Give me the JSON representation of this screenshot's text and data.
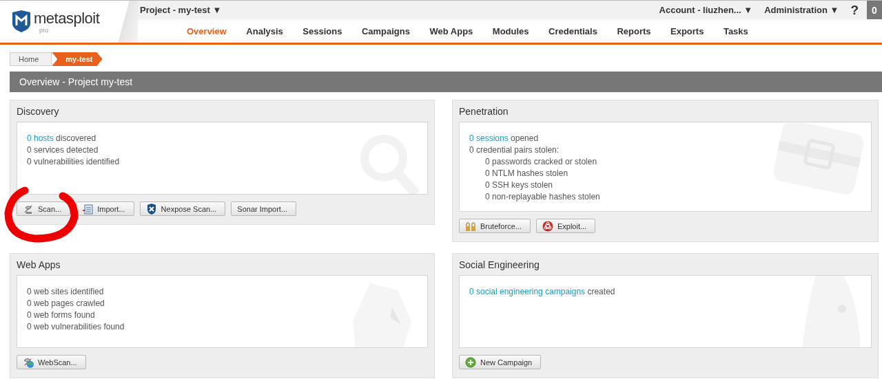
{
  "header": {
    "logo": {
      "name": "metasploit",
      "edition": "pro"
    },
    "project_menu": "Project - my-test ▼",
    "account_menu": "Account - liuzhen... ▼",
    "admin_menu": "Administration ▼",
    "help": "?",
    "notification_count": "0"
  },
  "nav": [
    {
      "label": "Overview",
      "selected": true
    },
    {
      "label": "Analysis",
      "selected": false
    },
    {
      "label": "Sessions",
      "selected": false
    },
    {
      "label": "Campaigns",
      "selected": false
    },
    {
      "label": "Web Apps",
      "selected": false
    },
    {
      "label": "Modules",
      "selected": false
    },
    {
      "label": "Credentials",
      "selected": false
    },
    {
      "label": "Reports",
      "selected": false
    },
    {
      "label": "Exports",
      "selected": false
    },
    {
      "label": "Tasks",
      "selected": false
    }
  ],
  "breadcrumb": [
    {
      "label": "Home",
      "selected": false
    },
    {
      "label": "my-test",
      "selected": true
    }
  ],
  "page_title": "Overview - Project my-test",
  "panels": [
    {
      "kind": "discovery",
      "title": "Discovery",
      "lines": [
        {
          "link": "0 hosts",
          "text": "discovered"
        },
        {
          "text": "0 services detected"
        },
        {
          "text": "0 vulnerabilities identified"
        }
      ],
      "buttons": [
        {
          "kind": "scan",
          "label": "Scan..."
        },
        {
          "kind": "import",
          "label": "Import..."
        },
        {
          "kind": "nexpose",
          "label": "Nexpose Scan..."
        },
        {
          "kind": "plain",
          "label": "Sonar Import..."
        }
      ]
    },
    {
      "kind": "penetration",
      "title": "Penetration",
      "lines": [
        {
          "link": "0 sessions",
          "text": "opened"
        },
        {
          "text": "0 credential pairs stolen:",
          "children": [
            {
              "text": "0 passwords cracked or stolen"
            },
            {
              "text": "0 NTLM hashes stolen"
            },
            {
              "text": "0 SSH keys stolen"
            },
            {
              "text": "0 non-replayable hashes stolen"
            }
          ]
        }
      ],
      "buttons": [
        {
          "kind": "bruteforce",
          "label": "Bruteforce..."
        },
        {
          "kind": "exploit",
          "label": "Exploit..."
        }
      ]
    },
    {
      "kind": "webapps",
      "title": "Web Apps",
      "lines": [
        {
          "text": "0 web sites identified"
        },
        {
          "text": "0 web pages crawled"
        },
        {
          "text": "0 web forms found"
        },
        {
          "text": "0 web vulnerabilities found"
        }
      ],
      "buttons": [
        {
          "kind": "webscan",
          "label": "WebScan..."
        }
      ]
    },
    {
      "kind": "social",
      "title": "Social Engineering",
      "lines": [
        {
          "link": "0 social engineering campaigns",
          "text": "created"
        }
      ],
      "buttons": [
        {
          "kind": "campaign",
          "label": "New Campaign"
        }
      ]
    }
  ]
}
